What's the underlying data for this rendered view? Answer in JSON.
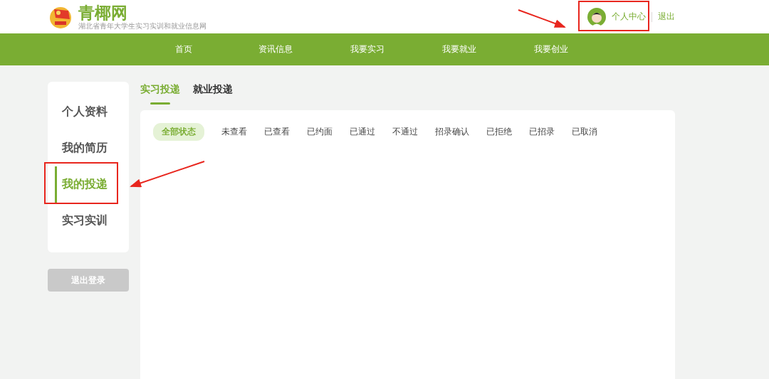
{
  "header": {
    "site_name": "青椰网",
    "tagline": "湖北省青年大学生实习实训和就业信息网",
    "user_link": "个人中心",
    "logout_link": "退出"
  },
  "nav": [
    {
      "label": "首页",
      "selected": false
    },
    {
      "label": "资讯信息",
      "selected": false
    },
    {
      "label": "我要实习",
      "selected": false
    },
    {
      "label": "我要就业",
      "selected": false
    },
    {
      "label": "我要创业",
      "selected": false
    }
  ],
  "sidebar": {
    "items": [
      {
        "label": "个人资料",
        "selected": false
      },
      {
        "label": "我的简历",
        "selected": false
      },
      {
        "label": "我的投递",
        "selected": true
      },
      {
        "label": "实习实训",
        "selected": false
      }
    ],
    "logout_button": "退出登录"
  },
  "tabs": [
    {
      "label": "实习投递",
      "selected": true
    },
    {
      "label": "就业投递",
      "selected": false
    }
  ],
  "filters": [
    {
      "label": "全部状态",
      "selected": true
    },
    {
      "label": "未查看",
      "selected": false
    },
    {
      "label": "已查看",
      "selected": false
    },
    {
      "label": "已约面",
      "selected": false
    },
    {
      "label": "已通过",
      "selected": false
    },
    {
      "label": "不通过",
      "selected": false
    },
    {
      "label": "招录确认",
      "selected": false
    },
    {
      "label": "已拒绝",
      "selected": false
    },
    {
      "label": "已招录",
      "selected": false
    },
    {
      "label": "已取消",
      "selected": false
    }
  ]
}
